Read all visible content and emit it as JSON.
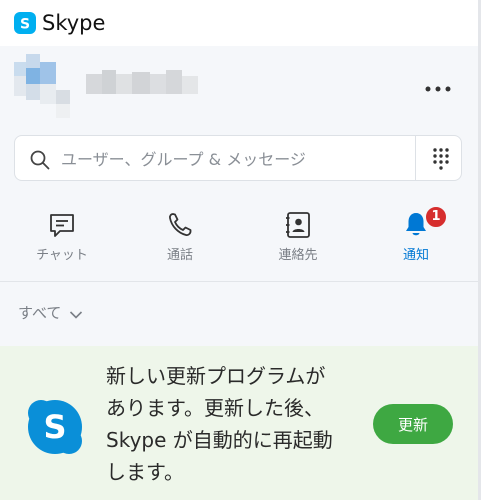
{
  "app": {
    "title": "Skype",
    "brand_color": "#00aff0"
  },
  "profile": {
    "avatar_icon": "avatar-pixelated",
    "more_icon": "more-horizontal-icon"
  },
  "search": {
    "placeholder": "ユーザー、グループ & メッセージ",
    "value": "",
    "search_icon": "search-icon",
    "dialpad_icon": "dialpad-icon"
  },
  "nav": {
    "tabs": [
      {
        "label": "チャット",
        "icon": "chat-icon",
        "active": false
      },
      {
        "label": "通話",
        "icon": "phone-icon",
        "active": false
      },
      {
        "label": "連絡先",
        "icon": "contacts-icon",
        "active": false
      },
      {
        "label": "通知",
        "icon": "bell-icon",
        "active": true,
        "badge": "1"
      }
    ],
    "accent_color": "#0078d4",
    "badge_color": "#d62e2e"
  },
  "filter": {
    "label": "すべて",
    "icon": "chevron-down-icon"
  },
  "update": {
    "message_lines": [
      "新しい更新プログラムが",
      "あります。更新した後、",
      "Skype が自動的に再起動",
      "します。"
    ],
    "button_label": "更新",
    "button_color": "#3ea842",
    "background_color": "#eef6ea"
  }
}
